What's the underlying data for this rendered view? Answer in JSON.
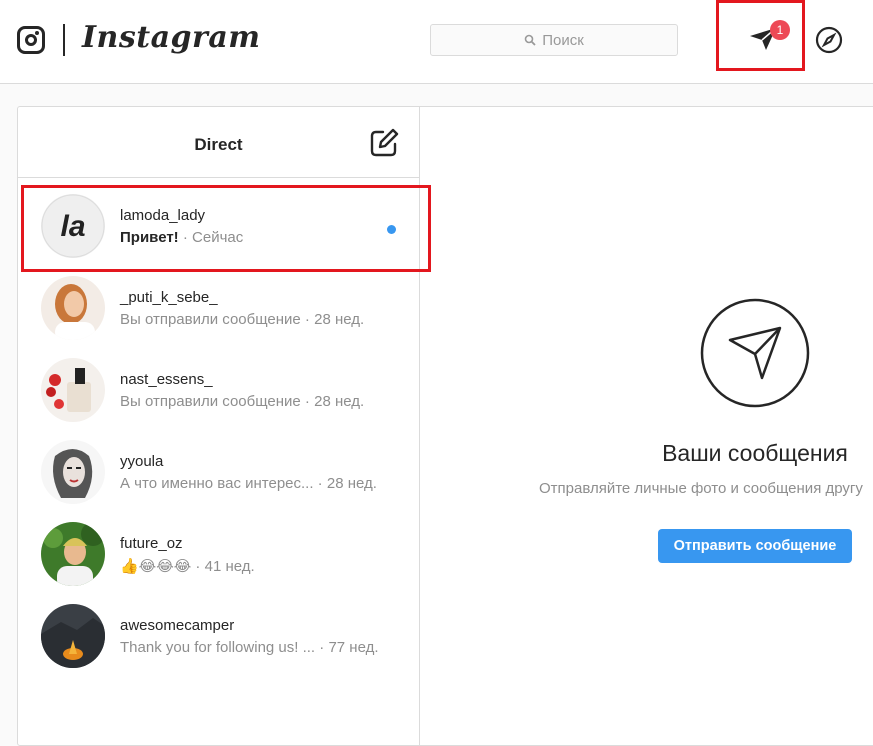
{
  "header": {
    "wordmark": "Instagram",
    "search_placeholder": "Поиск",
    "dm_badge": "1",
    "icons": {
      "logo": "instagram-camera-icon",
      "direct": "paper-plane-icon",
      "explore": "compass-icon",
      "search": "magnifier-icon"
    }
  },
  "direct": {
    "title": "Direct",
    "compose_icon": "edit-icon",
    "threads": [
      {
        "username": "lamoda_lady",
        "message": "Привет!",
        "time": "Сейчас",
        "unread": true,
        "avatar": "la"
      },
      {
        "username": "_puti_k_sebe_",
        "message": "Вы отправили сообщение",
        "time": "28 нед.",
        "unread": false
      },
      {
        "username": "nast_essens_",
        "message": "Вы отправили сообщение",
        "time": "28 нед.",
        "unread": false
      },
      {
        "username": "yyoula",
        "message": "А что именно вас интерес...",
        "time": "28 нед.",
        "unread": false
      },
      {
        "username": "future_oz",
        "message": "👍😂😂😂",
        "time": "41 нед.",
        "unread": false
      },
      {
        "username": "awesomecamper",
        "message": "Thank you for following us! ...",
        "time": "77 нед.",
        "unread": false
      }
    ]
  },
  "empty_state": {
    "title": "Ваши сообщения",
    "subtitle": "Отправляйте личные фото и сообщения другу",
    "button_label": "Отправить сообщение",
    "icon": "paper-plane-outline-icon"
  },
  "colors": {
    "accent": "#3897f0",
    "badge": "#ed4956",
    "highlight": "#e3171e"
  }
}
